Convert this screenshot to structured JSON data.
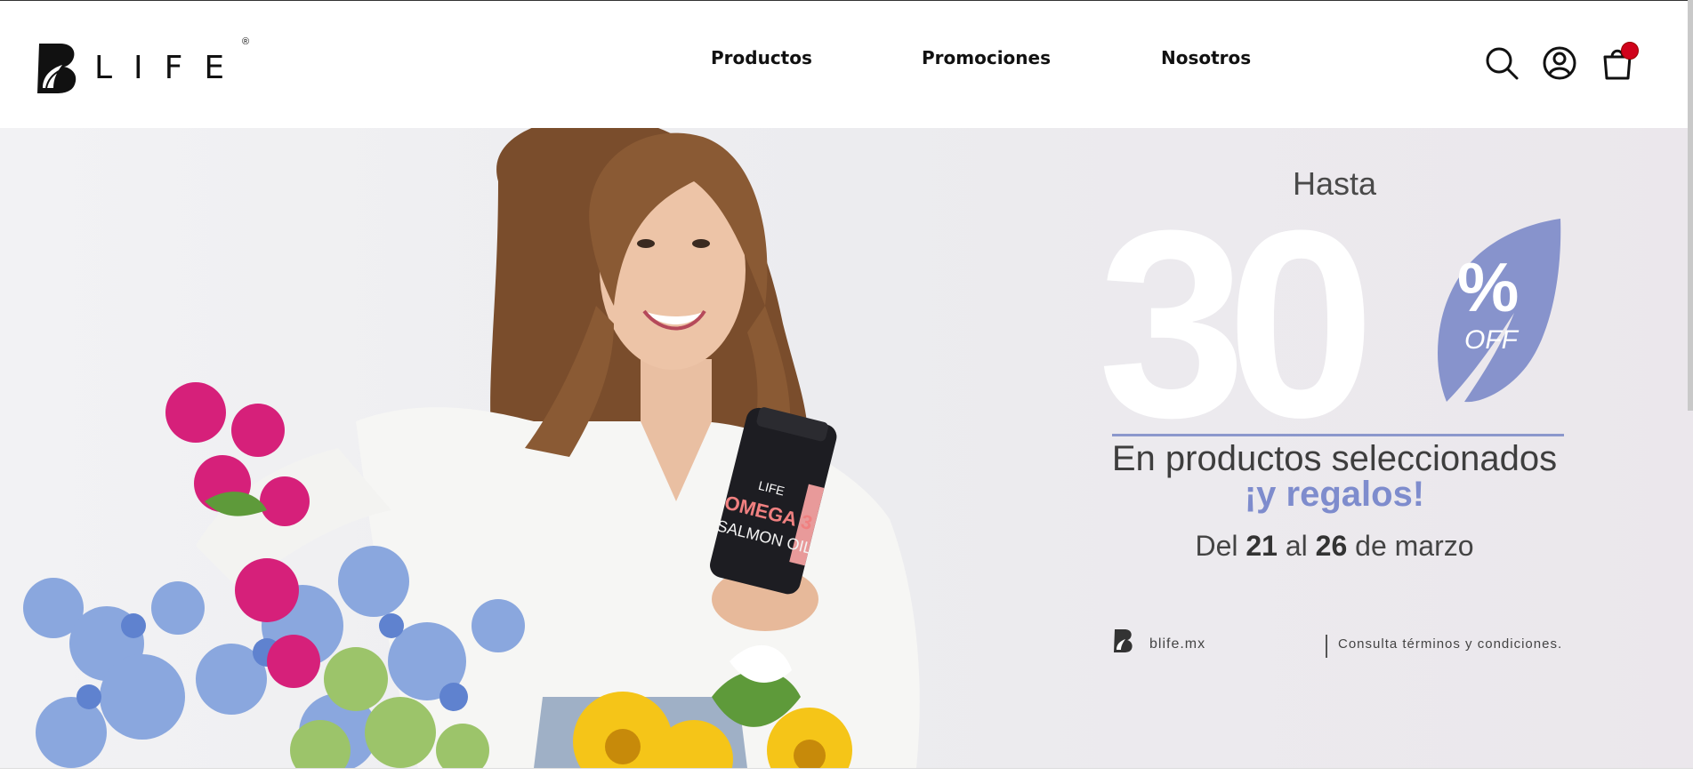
{
  "header": {
    "logo_text": "LIFE",
    "logo_reg": "®",
    "nav": [
      {
        "label": "Productos"
      },
      {
        "label": "Promociones"
      },
      {
        "label": "Nosotros"
      }
    ],
    "icons": [
      "search-icon",
      "user-icon",
      "cart-icon"
    ]
  },
  "hero": {
    "bottle": {
      "brand": "LIFE",
      "line1": "OMEGA 3",
      "line2": "SALMON OIL"
    },
    "promo": {
      "hasta": "Hasta",
      "big_number": "30",
      "percent": "%",
      "off": "OFF",
      "line1": "En productos seleccionados",
      "line2": "¡y regalos!",
      "dates_pre": "Del ",
      "day1": "21",
      "dates_mid": " al ",
      "day2": "26",
      "dates_post": " de marzo",
      "site": "blife.mx",
      "terms": "Consulta términos y condiciones."
    }
  },
  "colors": {
    "accent": "#8b97cc",
    "badge": "#d0021b"
  }
}
